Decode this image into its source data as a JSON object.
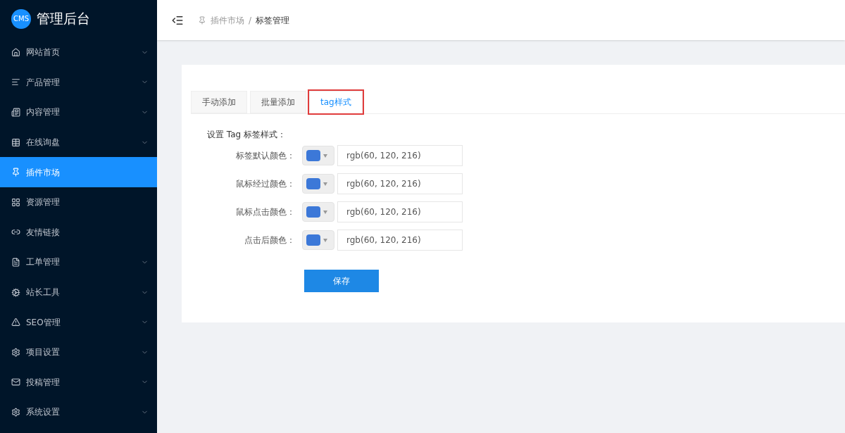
{
  "sidebar": {
    "logo": "CMS",
    "title": "管理后台",
    "items": [
      {
        "label": "网站首页",
        "expandable": true,
        "selected": false
      },
      {
        "label": "产品管理",
        "expandable": true,
        "selected": false
      },
      {
        "label": "内容管理",
        "expandable": true,
        "selected": false
      },
      {
        "label": "在线询盘",
        "expandable": true,
        "selected": false
      },
      {
        "label": "插件市场",
        "expandable": false,
        "selected": true
      },
      {
        "label": "资源管理",
        "expandable": false,
        "selected": false
      },
      {
        "label": "友情链接",
        "expandable": false,
        "selected": false
      },
      {
        "label": "工单管理",
        "expandable": true,
        "selected": false
      },
      {
        "label": "站长工具",
        "expandable": true,
        "selected": false
      },
      {
        "label": "SEO管理",
        "expandable": true,
        "selected": false
      },
      {
        "label": "项目设置",
        "expandable": true,
        "selected": false
      },
      {
        "label": "投稿管理",
        "expandable": true,
        "selected": false
      },
      {
        "label": "系统设置",
        "expandable": true,
        "selected": false
      }
    ]
  },
  "breadcrumb": [
    "插件市场",
    "标签管理"
  ],
  "breadcrumb_separator": "/",
  "tabs": [
    {
      "label": "手动添加",
      "selected": false,
      "highlighted": false
    },
    {
      "label": "批量添加",
      "selected": false,
      "highlighted": false
    },
    {
      "label": "tag样式",
      "selected": true,
      "highlighted": true
    }
  ],
  "form": {
    "heading": "设置 Tag 标签样式：",
    "fields": [
      {
        "label": "标签默认颜色：",
        "color": "#3c78d8",
        "value": "rgb(60, 120, 216)"
      },
      {
        "label": "鼠标经过颜色：",
        "color": "#3c78d8",
        "value": "rgb(60, 120, 216)"
      },
      {
        "label": "鼠标点击颜色：",
        "color": "#3c78d8",
        "value": "rgb(60, 120, 216)"
      },
      {
        "label": "点击后颜色：",
        "color": "#3c78d8",
        "value": "rgb(60, 120, 216)"
      }
    ],
    "save_button": "保存"
  }
}
